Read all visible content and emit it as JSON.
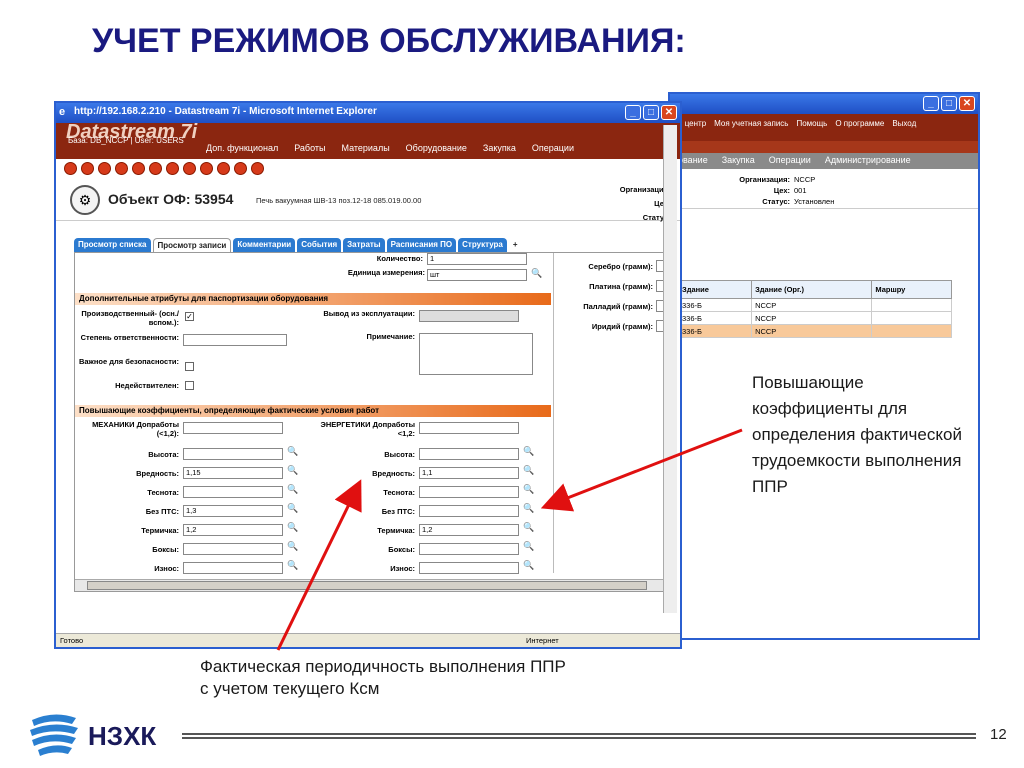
{
  "slide": {
    "title": "УЧЕТ РЕЖИМОВ ОБСЛУЖИВАНИЯ:",
    "annotation_right": "Повышающие коэффициенты для определения фактической трудоемкости выполнения ППР",
    "annotation_bottom_line1": "Фактическая периодичность выполнения ППР",
    "annotation_bottom_line2": "с учетом текущего Ксм",
    "logo_text": "НЗХК",
    "page_number": "12"
  },
  "back_window": {
    "menu": [
      "й центр",
      "Моя учетная запись",
      "Помощь",
      "О программе",
      "Выход"
    ],
    "nav": [
      "ование",
      "Закупка",
      "Операции",
      "Администрирование"
    ],
    "org_label": "Организация:",
    "org_value": "NCCP",
    "shop_label": "Цех:",
    "shop_value": "001",
    "status_label": "Статус:",
    "status_value": "Установлен",
    "table_headers": [
      "Здание",
      "Здание (Орг.)",
      "Маршру"
    ],
    "table_rows": [
      [
        "336-Б",
        "NCCP",
        ""
      ],
      [
        "336-Б",
        "NCCP",
        ""
      ],
      [
        "336-Б",
        "NCCP",
        ""
      ]
    ]
  },
  "front_window": {
    "title": "http://192.168.2.210 - Datastream 7i - Microsoft Internet Explorer",
    "brand": "Datastream 7i",
    "base_user": "База: DB_NCCP | User: USERS",
    "nav": [
      "Доп. функционал",
      "Работы",
      "Материалы",
      "Оборудование",
      "Закупка",
      "Операции"
    ],
    "object_title": "Объект ОФ: 53954",
    "object_desc": "Печь вакуумная ШВ-13 поз.12-18 085.019.00.00",
    "org_labels": [
      "Организация",
      "Цех",
      "Статус"
    ],
    "tabs": [
      "Просмотр списка",
      "Просмотр записи",
      "Комментарии",
      "События",
      "Затраты",
      "Расписания ПО",
      "Структура",
      "+"
    ],
    "status_ready": "Готово",
    "status_internet": "Интернет"
  },
  "form": {
    "qty_label": "Количество:",
    "qty_value": "1",
    "unit_label": "Единица измерения:",
    "unit_value": "шт",
    "silver_label": "Серебро (грамм):",
    "platinum_label": "Платина (грамм):",
    "palladium_label": "Палладий (грамм):",
    "iridium_label": "Иридий (грамм):",
    "sec1": "Дополнительные атрибуты для паспортизации оборудования",
    "production_label": "Производственный- (осн./вспом.):",
    "production_mark": "✓",
    "withdraw_label": "Вывод из эксплуатации:",
    "responsibility_label": "Степень ответственности:",
    "note_label": "Примечание:",
    "safety_label": "Важное для безопасности:",
    "invalid_label": "Недействителен:",
    "sec2": "Повышающие коэффициенты, определяющие фактические условия работ",
    "mech_label": "МЕХАНИКИ Допработы (<1,2):",
    "energy_label": "ЭНЕРГЕТИКИ Допработы <1,2:",
    "rows": [
      {
        "label": "Высота:",
        "left": "",
        "right": ""
      },
      {
        "label": "Вредность:",
        "left": "1,15",
        "right": "1,1"
      },
      {
        "label": "Теснота:",
        "left": "",
        "right": ""
      },
      {
        "label": "Без ПТС:",
        "left": "1,3",
        "right": ""
      },
      {
        "label": "Термичка:",
        "left": "1,2",
        "right": "1,2"
      },
      {
        "label": "Боксы:",
        "left": "",
        "right": ""
      },
      {
        "label": "Износ:",
        "left": "",
        "right": ""
      }
    ]
  },
  "colors": {
    "title": "#1a1a80",
    "brand_band": "#8b2610",
    "section_orange": "#e86a1a",
    "tab_blue": "#2b7ad0",
    "arrow_red": "#e01010"
  }
}
